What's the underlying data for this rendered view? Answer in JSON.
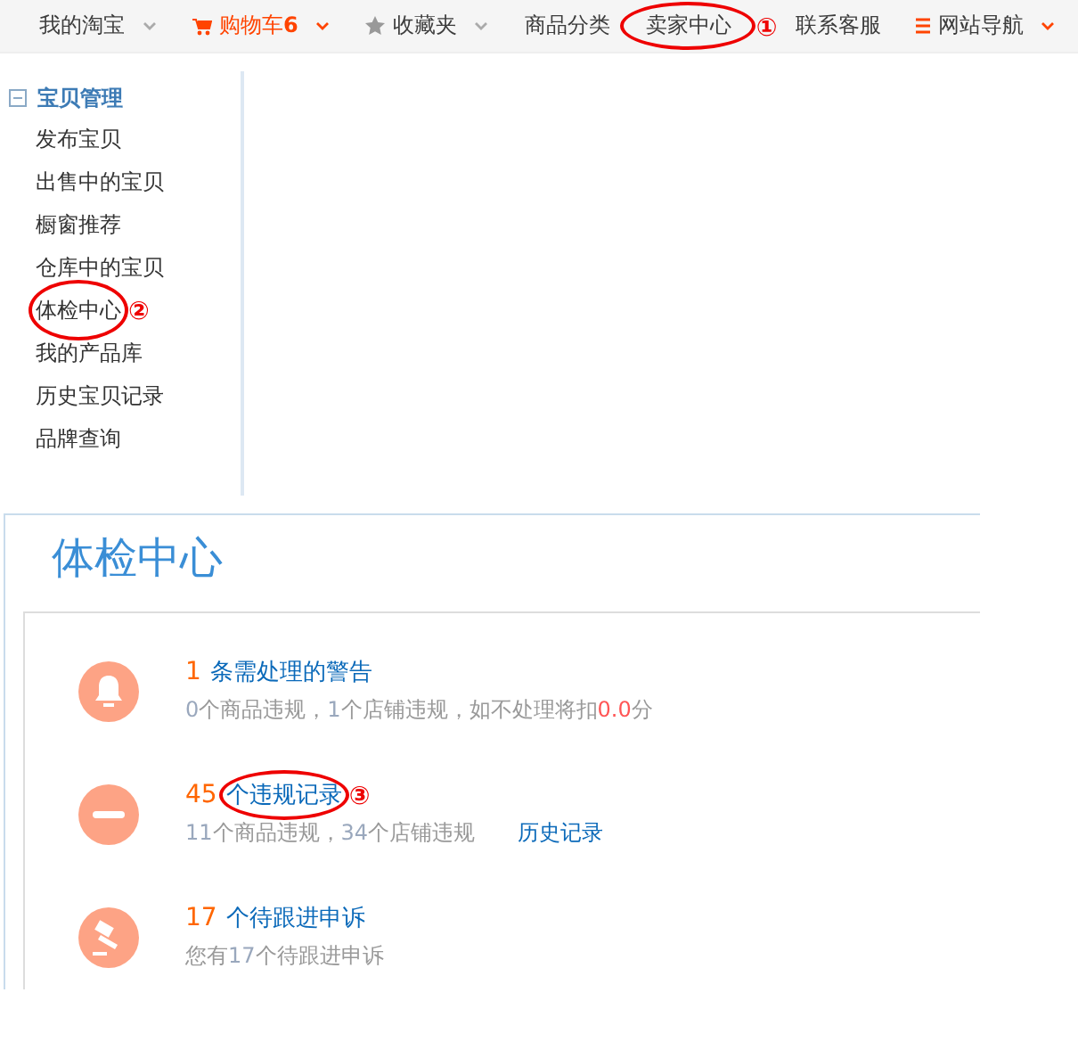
{
  "nav": [
    {
      "label": "我的淘宝",
      "kind": "plain",
      "caret": true,
      "highlight": false
    },
    {
      "label": "购物车",
      "kind": "cart",
      "count": "6",
      "caret": true,
      "highlight": true
    },
    {
      "label": "收藏夹",
      "kind": "favorites",
      "caret": true,
      "highlight": false
    },
    {
      "label": "商品分类",
      "kind": "plain",
      "caret": false,
      "highlight": false
    },
    {
      "label": "卖家中心",
      "kind": "plain",
      "caret": false,
      "highlight": false,
      "annotation": "①"
    },
    {
      "label": "联系客服",
      "kind": "plain",
      "caret": false,
      "highlight": false
    },
    {
      "label": "网站导航",
      "kind": "sitemap",
      "caret": true,
      "highlight": false
    }
  ],
  "sidebar": {
    "title": "宝贝管理",
    "expanded": true,
    "items": [
      {
        "label": "发布宝贝"
      },
      {
        "label": "出售中的宝贝"
      },
      {
        "label": "橱窗推荐"
      },
      {
        "label": "仓库中的宝贝"
      },
      {
        "label": "体检中心",
        "annotation": "②"
      },
      {
        "label": "我的产品库"
      },
      {
        "label": "历史宝贝记录"
      },
      {
        "label": "品牌查询"
      }
    ]
  },
  "page_title": "体检中心",
  "entries": [
    {
      "kind": "warning",
      "count": "1",
      "title": "条需处理的警告",
      "parts": [
        {
          "text": "0",
          "kind": "count"
        },
        {
          "text": "个商品违规，",
          "kind": "plain"
        },
        {
          "text": "1",
          "kind": "count"
        },
        {
          "text": "个店铺违规，如不处理将扣",
          "kind": "plain"
        },
        {
          "text": "0.0",
          "kind": "penalty"
        },
        {
          "text": "分",
          "kind": "plain"
        }
      ]
    },
    {
      "kind": "violation",
      "count": "45",
      "title": "个违规记录",
      "annotation": "③",
      "parts": [
        {
          "text": "11",
          "kind": "count"
        },
        {
          "text": "个商品违规，",
          "kind": "plain"
        },
        {
          "text": "34",
          "kind": "count"
        },
        {
          "text": "个店铺违规",
          "kind": "plain"
        }
      ],
      "link": "历史记录"
    },
    {
      "kind": "appeal",
      "count": "17",
      "title": "个待跟进申诉",
      "parts": [
        {
          "text": "您有",
          "kind": "plain"
        },
        {
          "text": "17",
          "kind": "count"
        },
        {
          "text": "个待跟进申诉",
          "kind": "plain"
        }
      ]
    }
  ]
}
